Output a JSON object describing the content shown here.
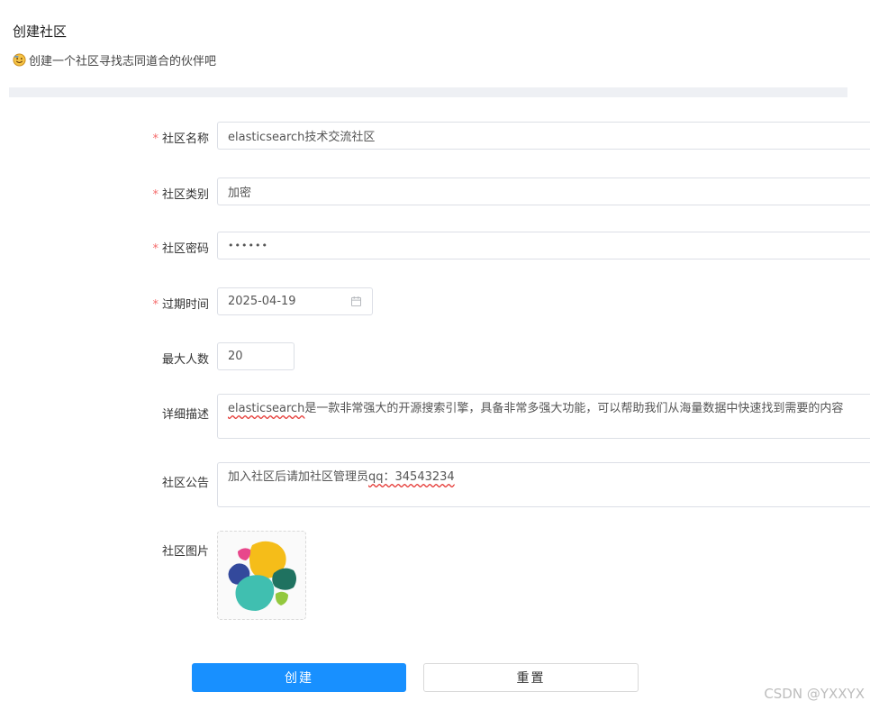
{
  "header": {
    "title": "创建社区",
    "subtitle": "创建一个社区寻找志同道合的伙伴吧"
  },
  "form": {
    "name": {
      "label": "社区名称",
      "required": true,
      "value": "elasticsearch技术交流社区"
    },
    "category": {
      "label": "社区类别",
      "required": true,
      "value": "加密"
    },
    "password": {
      "label": "社区密码",
      "required": true,
      "value": "••••••"
    },
    "expire": {
      "label": "过期时间",
      "required": true,
      "value": "2025-04-19",
      "icon": "calendar-icon"
    },
    "max_members": {
      "label": "最大人数",
      "required": false,
      "value": "20"
    },
    "description": {
      "label": "详细描述",
      "required": false,
      "value_word": "elasticsearch",
      "value_rest": "是一款非常强大的开源搜索引擎，具备非常多强大功能，可以帮助我们从海量数据中快速找到需要的内容"
    },
    "announcement": {
      "label": "社区公告",
      "required": false,
      "value_prefix": "加入社区后请加社区管理员",
      "value_qq": "qq：34543234"
    },
    "image": {
      "label": "社区图片",
      "required": false,
      "icon": "elastic-logo-icon"
    },
    "required_mark": "*"
  },
  "actions": {
    "create_label": "创建",
    "reset_label": "重置"
  },
  "watermark": "CSDN @YXXYX",
  "colors": {
    "primary": "#1890ff",
    "required": "#f56c6c",
    "border": "#dcdfe6",
    "band": "#eef0f4"
  }
}
